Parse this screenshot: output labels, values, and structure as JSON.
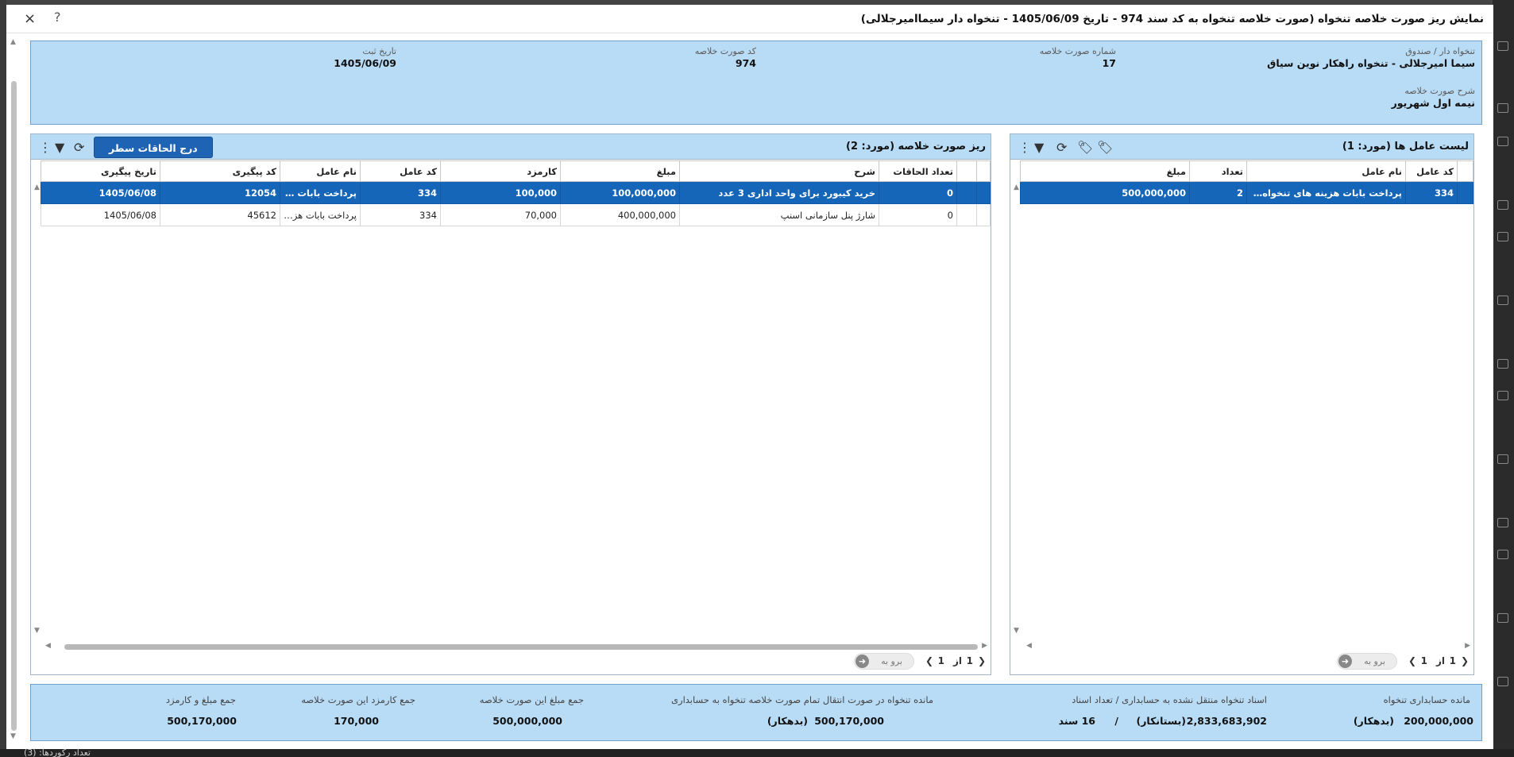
{
  "background": {
    "status_text": "تعداد رکوردها: (3)"
  },
  "modal": {
    "title": "نمایش ریز صورت خلاصه تنخواه (صورت خلاصه تنخواه به کد سند 974 - تاریخ 1405/06/09 - تنخواه دار سیماامیرجلالی)",
    "close_icon": "×",
    "help_icon": "?"
  },
  "info": {
    "tankhah_label": "تنخواه دار / صندوق",
    "tankhah_value": "سیما امیرجلالی - تنخواه راهکار نوین سیاق",
    "summary_no_label": "شماره صورت خلاصه",
    "summary_no_value": "17",
    "summary_code_label": "کد صورت خلاصه",
    "summary_code_value": "974",
    "reg_date_label": "تاریخ ثبت",
    "reg_date_value": "1405/06/09",
    "desc_label": "شرح صورت خلاصه",
    "desc_value": "نیمه اول شهریور"
  },
  "agents_panel": {
    "title": "لیست عامل ها (مورد: 1)",
    "columns": [
      "کد عامل",
      "نام عامل",
      "تعداد",
      "مبلغ"
    ],
    "rows": [
      {
        "code": "334",
        "name": "پرداخت بابات هزینه های تنخواه داری",
        "count": "2",
        "amount": "500,000,000"
      }
    ],
    "pager": {
      "page": "1",
      "of": "از",
      "total": "1",
      "goto": "برو به"
    }
  },
  "details_panel": {
    "title": "ریز صورت خلاصه (مورد: 2)",
    "insert_button": "درج الحاقات سطر",
    "columns": [
      "تعداد الحاقات",
      "شرح",
      "مبلغ",
      "کارمزد",
      "کد عامل",
      "نام عامل",
      "کد پیگیری",
      "تاریخ پیگیری"
    ],
    "rows": [
      {
        "attach": "0",
        "desc": "خرید کیبورد برای واحد اداری 3 عدد",
        "amount": "100,000,000",
        "fee": "100,000",
        "agent_code": "334",
        "agent_name": "پرداخت بابات هزینه...",
        "track_code": "12054",
        "track_date": "1405/06/08"
      },
      {
        "attach": "0",
        "desc": "شارژ پنل سازمانی اسنپ",
        "amount": "400,000,000",
        "fee": "70,000",
        "agent_code": "334",
        "agent_name": "پرداخت بابات هزینه...",
        "track_code": "45612",
        "track_date": "1405/06/08"
      }
    ],
    "pager": {
      "page": "1",
      "of": "از",
      "total": "1",
      "goto": "برو به"
    }
  },
  "summary": {
    "balance_label": "مانده حسابداری تنخواه",
    "balance_value": "200,000,000",
    "balance_type": "(بدهکار)",
    "docs_label": "اسناد تنخواه منتقل نشده به حسابداری / تعداد اسناد",
    "docs_value": "2,833,683,902",
    "docs_type": "(بستانکار)",
    "docs_sep": "/",
    "docs_count": "16 سند",
    "remain_label": "مانده تنخواه در صورت انتقال تمام صورت خلاصه تنخواه به حسابداری",
    "remain_value": "500,170,000",
    "remain_type": "(بدهکار)",
    "sum_amount_label": "جمع مبلغ این صورت خلاصه",
    "sum_amount_value": "500,000,000",
    "sum_fee_label": "جمع کارمزد این صورت خلاصه",
    "sum_fee_value": "170,000",
    "sum_total_label": "جمع مبلغ و کارمزد",
    "sum_total_value": "500,170,000"
  }
}
